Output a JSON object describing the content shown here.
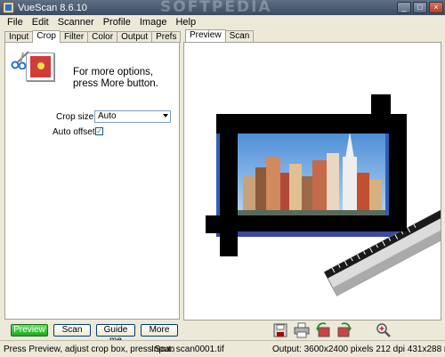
{
  "window": {
    "title": "VueScan 8.6.10",
    "watermark": "SOFTPEDIA",
    "minimize": "_",
    "maximize": "□",
    "close": "×"
  },
  "menu": [
    "File",
    "Edit",
    "Scanner",
    "Profile",
    "Image",
    "Help"
  ],
  "left_tabs": [
    {
      "label": "Input",
      "active": false
    },
    {
      "label": "Crop",
      "active": true
    },
    {
      "label": "Filter",
      "active": false
    },
    {
      "label": "Color",
      "active": false
    },
    {
      "label": "Output",
      "active": false
    },
    {
      "label": "Prefs",
      "active": false
    }
  ],
  "crop_panel": {
    "info_line1": "For more options,",
    "info_line2": "press More button.",
    "crop_size_label": "Crop size:",
    "crop_size_value": "Auto",
    "auto_offset_label": "Auto offset:",
    "auto_offset_checked": true,
    "check_glyph": "✓"
  },
  "buttons": {
    "preview": "Preview",
    "scan": "Scan",
    "guide": "Guide me",
    "more": "More"
  },
  "right_tabs": [
    {
      "label": "Preview",
      "active": true
    },
    {
      "label": "Scan",
      "active": false
    }
  ],
  "toolbar_icons": [
    "save-icon",
    "print-icon",
    "rotate-left-icon",
    "rotate-right-icon",
    "zoom-icon"
  ],
  "status": {
    "hint": "Press Preview, adjust crop box, press Scan",
    "input": "Input:  scan0001.tif",
    "output": "Output:  3600x2400 pixels 212 dpi 431x288 r"
  },
  "colors": {
    "preview_button": "#1fa81f",
    "titlebar": "#3d4b60"
  }
}
